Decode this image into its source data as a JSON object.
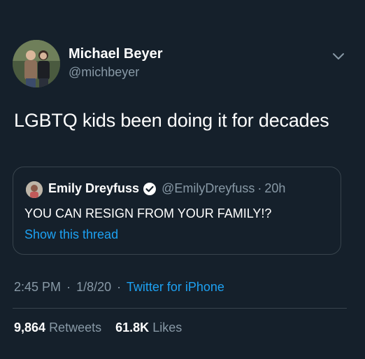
{
  "author": {
    "name": "Michael Beyer",
    "handle": "@michbeyer"
  },
  "tweet": {
    "text": "LGBTQ kids been doing it for decades"
  },
  "quoted_tweet": {
    "name": "Emily Dreyfuss",
    "handle": "@EmilyDreyfuss",
    "separator": "·",
    "age": "20h",
    "text": "YOU CAN RESIGN FROM YOUR FAMILY!?",
    "show_thread_label": "Show this thread"
  },
  "meta": {
    "time": "2:45 PM",
    "sep1": "·",
    "date": "1/8/20",
    "sep2": "·",
    "source": "Twitter for iPhone"
  },
  "stats": {
    "retweets_count": "9,864",
    "retweets_label": "Retweets",
    "likes_count": "61.8K",
    "likes_label": "Likes"
  },
  "colors": {
    "background": "#15202b",
    "accent": "#1da1f2",
    "secondary_text": "#8899a6",
    "border": "#38444d"
  },
  "icons": {
    "caret": "chevron-down-icon",
    "verified": "verified-badge-icon"
  }
}
